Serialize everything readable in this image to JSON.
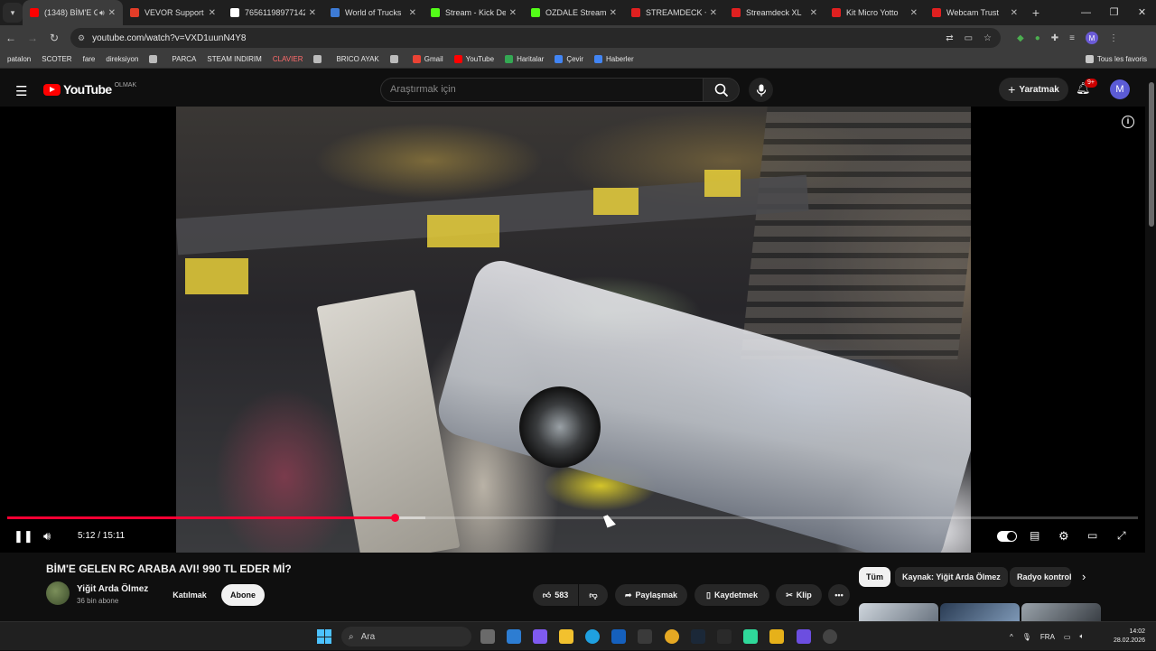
{
  "browser": {
    "tabs": [
      {
        "title": "(1348) BİM'E G",
        "favicon_color": "#ff0000",
        "active": true,
        "sound": true
      },
      {
        "title": "VEVOR Support o",
        "favicon_color": "#e23d28"
      },
      {
        "title": "76561198977142",
        "favicon_color": "#ffffff"
      },
      {
        "title": "World of Trucks",
        "favicon_color": "#3d7bd6"
      },
      {
        "title": "Stream - Kick Des",
        "favicon_color": "#53fc18"
      },
      {
        "title": "OZDALE Stream -",
        "favicon_color": "#53fc18"
      },
      {
        "title": "STREAMDECK + (",
        "favicon_color": "#e02020"
      },
      {
        "title": "Streamdeck XL",
        "favicon_color": "#e02020"
      },
      {
        "title": "Kit Micro Yotto",
        "favicon_color": "#e02020"
      },
      {
        "title": "Webcam Trust",
        "favicon_color": "#e02020"
      }
    ],
    "url": "youtube.com/watch?v=VXD1uunN4Y8",
    "profile_initial": "M",
    "bookmarks": [
      {
        "label": "patalon"
      },
      {
        "label": "SCOTER"
      },
      {
        "label": "fare"
      },
      {
        "label": "direksiyon"
      },
      {
        "label": "",
        "folder": true
      },
      {
        "label": "PARCA"
      },
      {
        "label": "STEAM INDIRIM"
      },
      {
        "label": "CLAVIER",
        "red": true
      },
      {
        "label": "",
        "folder": true
      },
      {
        "label": "BRICO AYAK"
      },
      {
        "label": "",
        "grid": true
      },
      {
        "label": "Gmail",
        "icon": true
      },
      {
        "label": "YouTube",
        "icon": true
      },
      {
        "label": "Haritalar",
        "icon": true
      },
      {
        "label": "Çevir",
        "icon": true
      },
      {
        "label": "Haberler",
        "icon": true
      }
    ],
    "all_bookmarks": "Tous les favoris"
  },
  "youtube": {
    "logo": "YouTube",
    "country": "OLMAK",
    "search_placeholder": "Araştırmak için",
    "create_label": "Yaratmak",
    "notif_badge": "9+",
    "avatar_initial": "M"
  },
  "player": {
    "time": "5:12 / 15:11",
    "progress": 0.343,
    "buffered": 0.37
  },
  "video": {
    "title": "BİM'E GELEN RC ARABA AVI! 990 TL EDER Mİ?",
    "channel": "Yiğit Arda Ölmez",
    "subscribers": "36 bin abone",
    "join_label": "Katılmak",
    "subscribe_label": "Abone",
    "likes": "583",
    "share_label": "Paylaşmak",
    "save_label": "Kaydetmek",
    "clip_label": "Klip"
  },
  "chips": [
    "Tüm",
    "Kaynak: Yiğit Arda Ölmez",
    "Radyo kontrol"
  ],
  "taskbar": {
    "search_placeholder": "Ara",
    "language": "FRA",
    "time": "14:02",
    "date": "28.02.2026"
  }
}
